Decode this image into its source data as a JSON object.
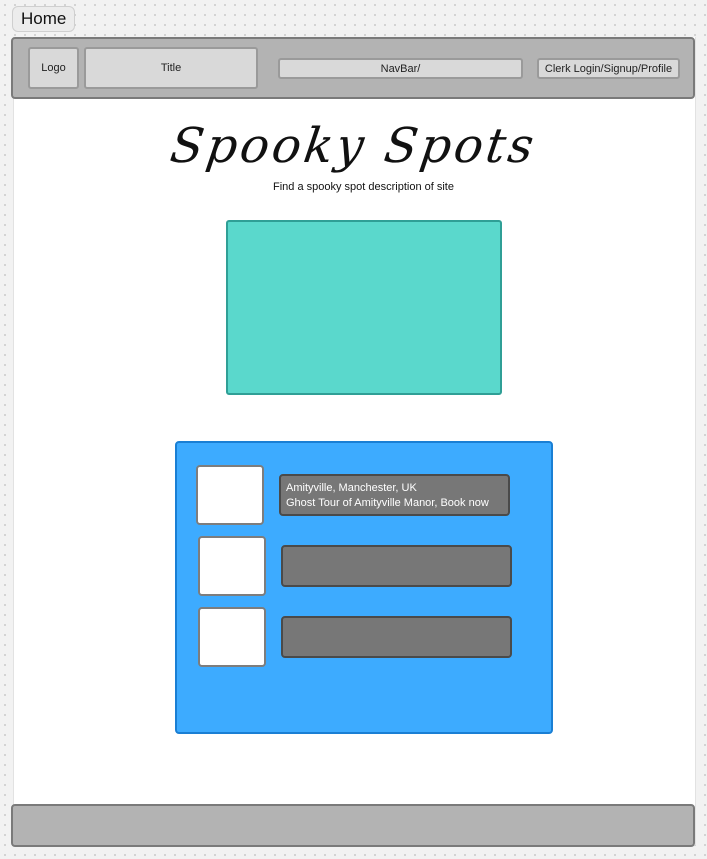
{
  "frame": {
    "label": "Home"
  },
  "header": {
    "logo": "Logo",
    "title": "Title",
    "navbar": "NavBar/",
    "auth": "Clerk Login/Signup/Profile"
  },
  "main": {
    "title": "Spooky Spots",
    "subtitle": "Find a spooky spot description of site"
  },
  "listings": [
    {
      "line1": "Amityville, Manchester, UK",
      "line2": "Ghost Tour of Amityville Manor, Book now"
    },
    {
      "line1": "",
      "line2": ""
    },
    {
      "line1": "",
      "line2": ""
    }
  ],
  "colors": {
    "header": "#b3b3b3",
    "hero": "#5ad8cc",
    "panel": "#3dabff",
    "info_card": "#777777"
  }
}
